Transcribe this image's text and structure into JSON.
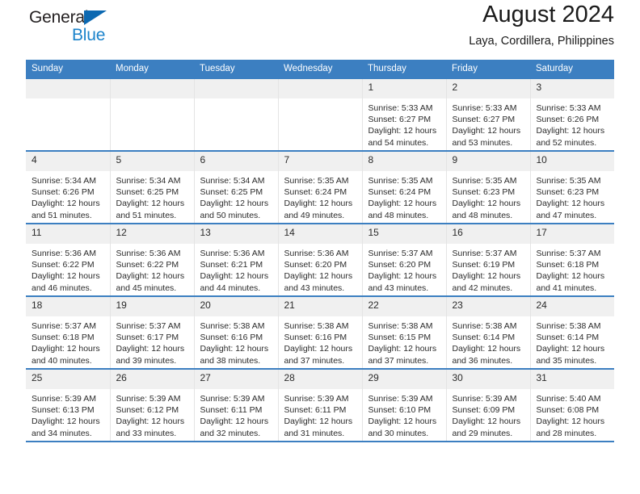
{
  "logo": {
    "word_top": "General",
    "word_bottom": "Blue",
    "triangle_icon": "triangle-icon",
    "brand_blue": "#1b83cb",
    "triangle_blue": "#0b68b1"
  },
  "header": {
    "title": "August 2024",
    "subtitle": "Laya, Cordillera, Philippines"
  },
  "calendar": {
    "header_background": "#3c7fc1",
    "header_text_color": "#ffffff",
    "daynum_background": "#f0f0f0",
    "weekdays": [
      "Sunday",
      "Monday",
      "Tuesday",
      "Wednesday",
      "Thursday",
      "Friday",
      "Saturday"
    ],
    "weeks": [
      [
        {
          "day": "",
          "empty": true
        },
        {
          "day": "",
          "empty": true
        },
        {
          "day": "",
          "empty": true
        },
        {
          "day": "",
          "empty": true
        },
        {
          "day": "1",
          "sunrise": "Sunrise: 5:33 AM",
          "sunset": "Sunset: 6:27 PM",
          "daylight_1": "Daylight: 12 hours",
          "daylight_2": "and 54 minutes."
        },
        {
          "day": "2",
          "sunrise": "Sunrise: 5:33 AM",
          "sunset": "Sunset: 6:27 PM",
          "daylight_1": "Daylight: 12 hours",
          "daylight_2": "and 53 minutes."
        },
        {
          "day": "3",
          "sunrise": "Sunrise: 5:33 AM",
          "sunset": "Sunset: 6:26 PM",
          "daylight_1": "Daylight: 12 hours",
          "daylight_2": "and 52 minutes."
        }
      ],
      [
        {
          "day": "4",
          "sunrise": "Sunrise: 5:34 AM",
          "sunset": "Sunset: 6:26 PM",
          "daylight_1": "Daylight: 12 hours",
          "daylight_2": "and 51 minutes."
        },
        {
          "day": "5",
          "sunrise": "Sunrise: 5:34 AM",
          "sunset": "Sunset: 6:25 PM",
          "daylight_1": "Daylight: 12 hours",
          "daylight_2": "and 51 minutes."
        },
        {
          "day": "6",
          "sunrise": "Sunrise: 5:34 AM",
          "sunset": "Sunset: 6:25 PM",
          "daylight_1": "Daylight: 12 hours",
          "daylight_2": "and 50 minutes."
        },
        {
          "day": "7",
          "sunrise": "Sunrise: 5:35 AM",
          "sunset": "Sunset: 6:24 PM",
          "daylight_1": "Daylight: 12 hours",
          "daylight_2": "and 49 minutes."
        },
        {
          "day": "8",
          "sunrise": "Sunrise: 5:35 AM",
          "sunset": "Sunset: 6:24 PM",
          "daylight_1": "Daylight: 12 hours",
          "daylight_2": "and 48 minutes."
        },
        {
          "day": "9",
          "sunrise": "Sunrise: 5:35 AM",
          "sunset": "Sunset: 6:23 PM",
          "daylight_1": "Daylight: 12 hours",
          "daylight_2": "and 48 minutes."
        },
        {
          "day": "10",
          "sunrise": "Sunrise: 5:35 AM",
          "sunset": "Sunset: 6:23 PM",
          "daylight_1": "Daylight: 12 hours",
          "daylight_2": "and 47 minutes."
        }
      ],
      [
        {
          "day": "11",
          "sunrise": "Sunrise: 5:36 AM",
          "sunset": "Sunset: 6:22 PM",
          "daylight_1": "Daylight: 12 hours",
          "daylight_2": "and 46 minutes."
        },
        {
          "day": "12",
          "sunrise": "Sunrise: 5:36 AM",
          "sunset": "Sunset: 6:22 PM",
          "daylight_1": "Daylight: 12 hours",
          "daylight_2": "and 45 minutes."
        },
        {
          "day": "13",
          "sunrise": "Sunrise: 5:36 AM",
          "sunset": "Sunset: 6:21 PM",
          "daylight_1": "Daylight: 12 hours",
          "daylight_2": "and 44 minutes."
        },
        {
          "day": "14",
          "sunrise": "Sunrise: 5:36 AM",
          "sunset": "Sunset: 6:20 PM",
          "daylight_1": "Daylight: 12 hours",
          "daylight_2": "and 43 minutes."
        },
        {
          "day": "15",
          "sunrise": "Sunrise: 5:37 AM",
          "sunset": "Sunset: 6:20 PM",
          "daylight_1": "Daylight: 12 hours",
          "daylight_2": "and 43 minutes."
        },
        {
          "day": "16",
          "sunrise": "Sunrise: 5:37 AM",
          "sunset": "Sunset: 6:19 PM",
          "daylight_1": "Daylight: 12 hours",
          "daylight_2": "and 42 minutes."
        },
        {
          "day": "17",
          "sunrise": "Sunrise: 5:37 AM",
          "sunset": "Sunset: 6:18 PM",
          "daylight_1": "Daylight: 12 hours",
          "daylight_2": "and 41 minutes."
        }
      ],
      [
        {
          "day": "18",
          "sunrise": "Sunrise: 5:37 AM",
          "sunset": "Sunset: 6:18 PM",
          "daylight_1": "Daylight: 12 hours",
          "daylight_2": "and 40 minutes."
        },
        {
          "day": "19",
          "sunrise": "Sunrise: 5:37 AM",
          "sunset": "Sunset: 6:17 PM",
          "daylight_1": "Daylight: 12 hours",
          "daylight_2": "and 39 minutes."
        },
        {
          "day": "20",
          "sunrise": "Sunrise: 5:38 AM",
          "sunset": "Sunset: 6:16 PM",
          "daylight_1": "Daylight: 12 hours",
          "daylight_2": "and 38 minutes."
        },
        {
          "day": "21",
          "sunrise": "Sunrise: 5:38 AM",
          "sunset": "Sunset: 6:16 PM",
          "daylight_1": "Daylight: 12 hours",
          "daylight_2": "and 37 minutes."
        },
        {
          "day": "22",
          "sunrise": "Sunrise: 5:38 AM",
          "sunset": "Sunset: 6:15 PM",
          "daylight_1": "Daylight: 12 hours",
          "daylight_2": "and 37 minutes."
        },
        {
          "day": "23",
          "sunrise": "Sunrise: 5:38 AM",
          "sunset": "Sunset: 6:14 PM",
          "daylight_1": "Daylight: 12 hours",
          "daylight_2": "and 36 minutes."
        },
        {
          "day": "24",
          "sunrise": "Sunrise: 5:38 AM",
          "sunset": "Sunset: 6:14 PM",
          "daylight_1": "Daylight: 12 hours",
          "daylight_2": "and 35 minutes."
        }
      ],
      [
        {
          "day": "25",
          "sunrise": "Sunrise: 5:39 AM",
          "sunset": "Sunset: 6:13 PM",
          "daylight_1": "Daylight: 12 hours",
          "daylight_2": "and 34 minutes."
        },
        {
          "day": "26",
          "sunrise": "Sunrise: 5:39 AM",
          "sunset": "Sunset: 6:12 PM",
          "daylight_1": "Daylight: 12 hours",
          "daylight_2": "and 33 minutes."
        },
        {
          "day": "27",
          "sunrise": "Sunrise: 5:39 AM",
          "sunset": "Sunset: 6:11 PM",
          "daylight_1": "Daylight: 12 hours",
          "daylight_2": "and 32 minutes."
        },
        {
          "day": "28",
          "sunrise": "Sunrise: 5:39 AM",
          "sunset": "Sunset: 6:11 PM",
          "daylight_1": "Daylight: 12 hours",
          "daylight_2": "and 31 minutes."
        },
        {
          "day": "29",
          "sunrise": "Sunrise: 5:39 AM",
          "sunset": "Sunset: 6:10 PM",
          "daylight_1": "Daylight: 12 hours",
          "daylight_2": "and 30 minutes."
        },
        {
          "day": "30",
          "sunrise": "Sunrise: 5:39 AM",
          "sunset": "Sunset: 6:09 PM",
          "daylight_1": "Daylight: 12 hours",
          "daylight_2": "and 29 minutes."
        },
        {
          "day": "31",
          "sunrise": "Sunrise: 5:40 AM",
          "sunset": "Sunset: 6:08 PM",
          "daylight_1": "Daylight: 12 hours",
          "daylight_2": "and 28 minutes."
        }
      ]
    ]
  }
}
